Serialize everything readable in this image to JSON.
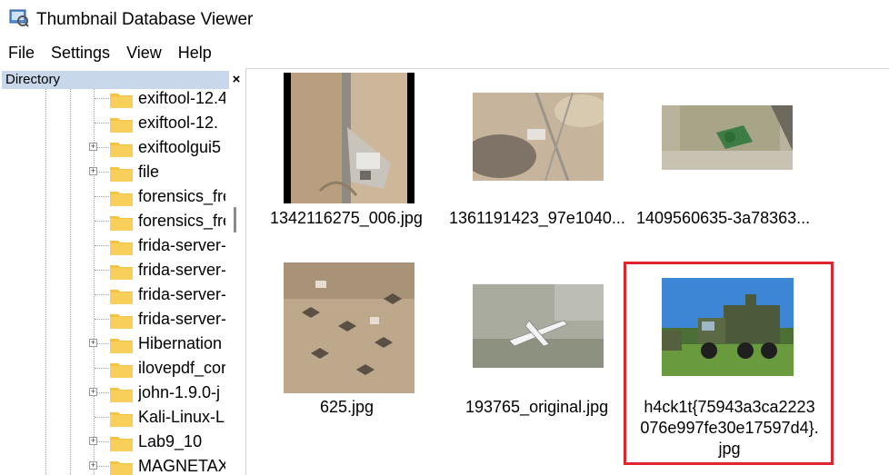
{
  "window": {
    "title": "Thumbnail Database Viewer"
  },
  "menu": {
    "items": [
      "File",
      "Settings",
      "View",
      "Help"
    ]
  },
  "directory": {
    "header": "Directory",
    "close_symbol": "×",
    "items": [
      {
        "label": "exiftool-12.4",
        "expand": false
      },
      {
        "label": "exiftool-12.",
        "expand": false
      },
      {
        "label": "exiftoolgui5",
        "expand": true
      },
      {
        "label": "file",
        "expand": true
      },
      {
        "label": "forensics_fre",
        "expand": false
      },
      {
        "label": "forensics_fre",
        "expand": false
      },
      {
        "label": "frida-server-",
        "expand": false
      },
      {
        "label": "frida-server-",
        "expand": false
      },
      {
        "label": "frida-server-",
        "expand": false
      },
      {
        "label": "frida-server-",
        "expand": false
      },
      {
        "label": "Hibernation",
        "expand": true
      },
      {
        "label": "ilovepdf_cor",
        "expand": false
      },
      {
        "label": "john-1.9.0-j",
        "expand": true
      },
      {
        "label": "Kali-Linux-L",
        "expand": false
      },
      {
        "label": "Lab9_10",
        "expand": true
      },
      {
        "label": "MAGNETAX",
        "expand": true
      }
    ]
  },
  "thumbnails": [
    {
      "caption": "1342116275_006.jpg"
    },
    {
      "caption": "1361191423_97e1040..."
    },
    {
      "caption": "1409560635-3a78363..."
    },
    {
      "caption": "625.jpg"
    },
    {
      "caption": "193765_original.jpg"
    },
    {
      "caption_lines": [
        "h4ck1t{75943a3ca2223",
        "076e997fe30e17597d4}.",
        "jpg"
      ]
    }
  ],
  "colors": {
    "highlight": "#e0242e",
    "dir_header_bg": "#c8d7ea",
    "folder": "#f5c242"
  }
}
